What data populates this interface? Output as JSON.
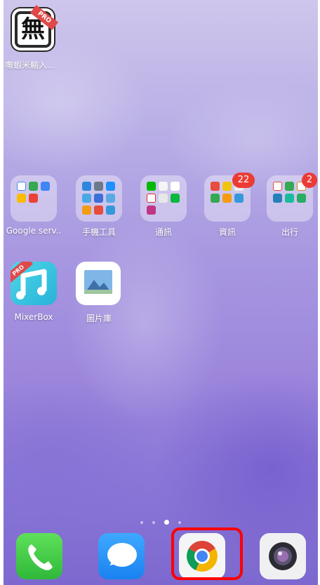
{
  "top_app": {
    "label": "嘸蝦米輸入...",
    "icon_char": "無",
    "badge": "PRO"
  },
  "folders": [
    {
      "label": "Google serv..",
      "icon": "folder-icon"
    },
    {
      "label": "手機工具",
      "icon": "folder-icon"
    },
    {
      "label": "通訊",
      "icon": "folder-icon"
    },
    {
      "label": "資訊",
      "icon": "folder-icon",
      "badge": "22"
    },
    {
      "label": "出行",
      "icon": "folder-icon",
      "badge": "2"
    }
  ],
  "apps_row": [
    {
      "label": "MixerBox",
      "badge": "PRO"
    },
    {
      "label": "圖片庫"
    }
  ],
  "dock": [
    {
      "name": "phone"
    },
    {
      "name": "messages"
    },
    {
      "name": "chrome",
      "highlighted": true
    },
    {
      "name": "camera"
    }
  ],
  "page_indicator": {
    "pages": 4,
    "current": 3
  },
  "colors": {
    "highlight": "#ff0000",
    "badge": "#ec3b35"
  }
}
